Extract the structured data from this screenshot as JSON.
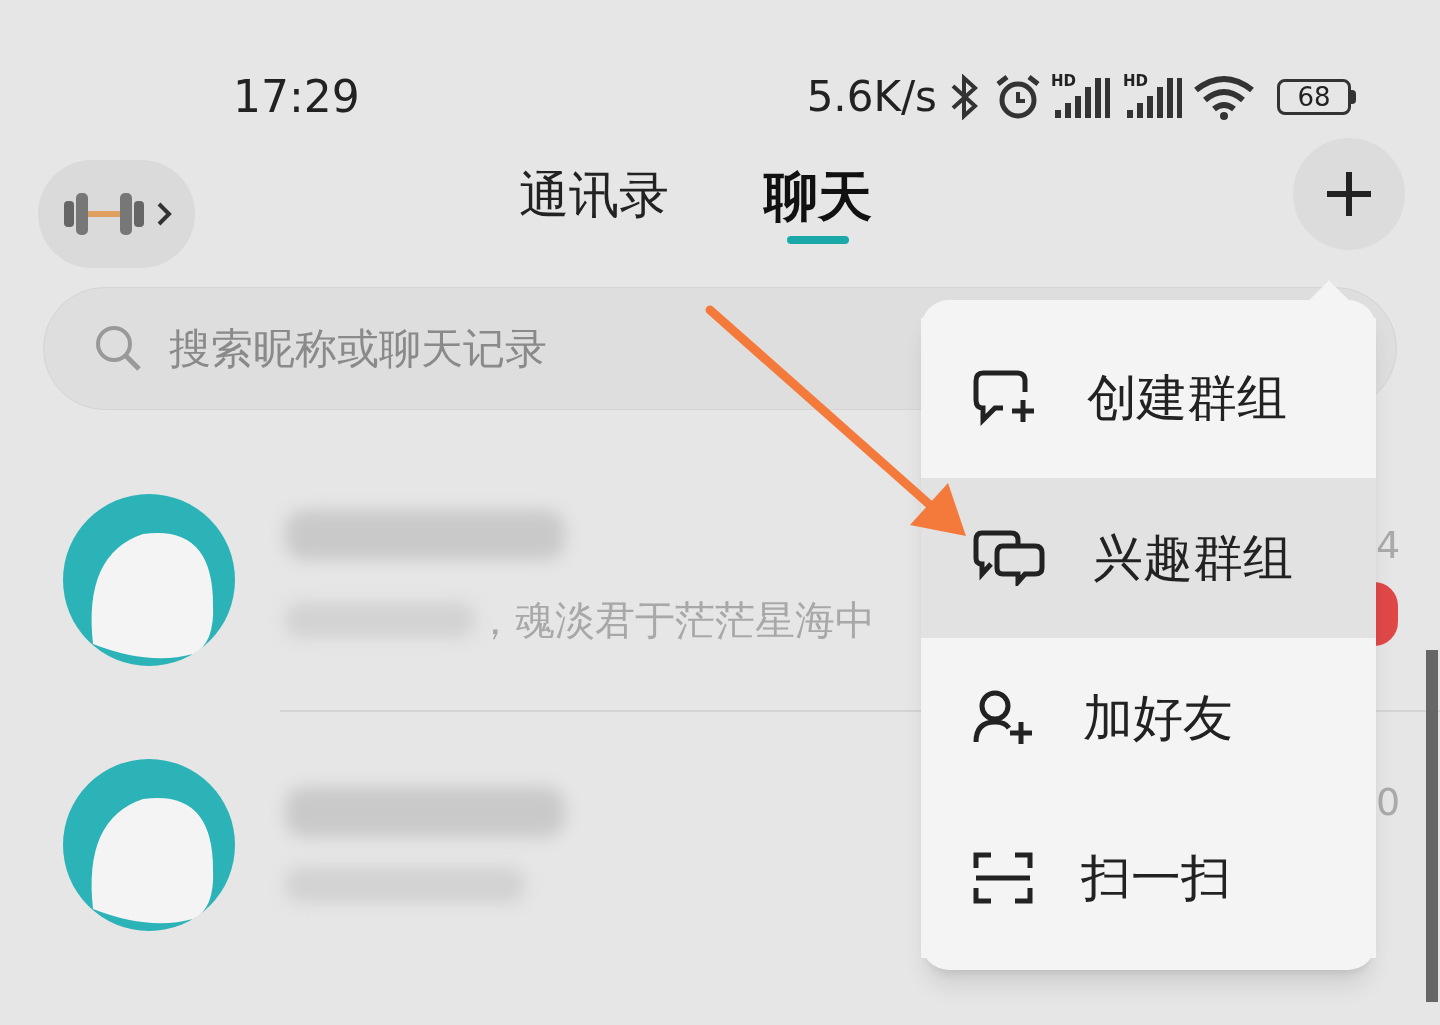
{
  "status_bar": {
    "time": "17:29",
    "speed": "5.6K/s",
    "signal_labels": [
      "HD",
      "HD"
    ],
    "battery": "68"
  },
  "tabs": [
    {
      "label": "通讯录",
      "selected": false
    },
    {
      "label": "聊天",
      "selected": true
    }
  ],
  "search": {
    "placeholder": "搜索昵称或聊天记录"
  },
  "chats": [
    {
      "preview": "，魂淡君于茫茫星海中",
      "time": "4",
      "unread": true
    },
    {
      "time": "0",
      "unread": false
    }
  ],
  "menu": {
    "items": [
      {
        "kind": "create-group",
        "label": "创建群组",
        "selected": false
      },
      {
        "kind": "interest-group",
        "label": "兴趣群组",
        "selected": true
      },
      {
        "kind": "add-friend",
        "label": "加好友",
        "selected": false
      },
      {
        "kind": "scan",
        "label": "扫一扫",
        "selected": false
      }
    ]
  }
}
